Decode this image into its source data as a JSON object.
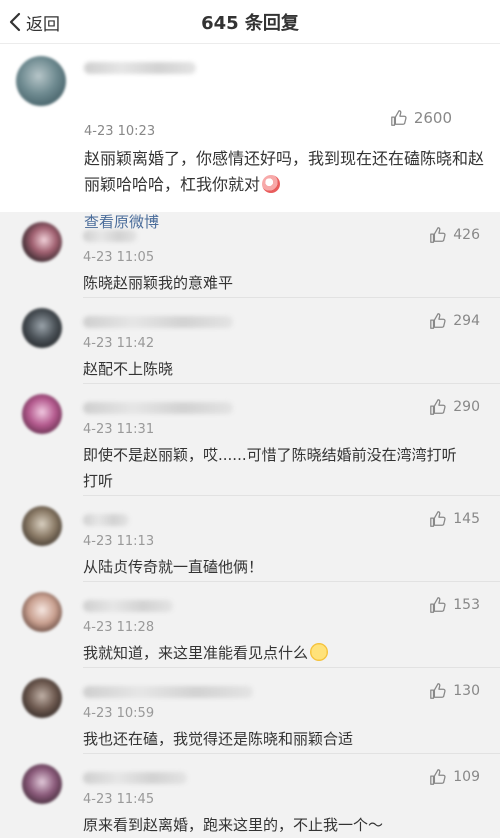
{
  "header": {
    "back_label": "返回",
    "title": "645 条回复"
  },
  "main_comment": {
    "time": "4-23 10:23",
    "likes": "2600",
    "text": "赵丽颖离婚了，你感情还好吗，我到现在还在磕陈晓和赵丽颖哈哈哈，杠我你就对",
    "view_original": "查看原微博"
  },
  "replies": [
    {
      "time": "4-23 11:05",
      "likes": "426",
      "text": "陈晓赵丽颖我的意难平"
    },
    {
      "time": "4-23 11:42",
      "likes": "294",
      "text": "赵配不上陈晓"
    },
    {
      "time": "4-23 11:31",
      "likes": "290",
      "text": "即使不是赵丽颖，哎......可惜了陈晓结婚前没在湾湾打听打听"
    },
    {
      "time": "4-23 11:13",
      "likes": "145",
      "text": "从陆贞传奇就一直磕他俩！"
    },
    {
      "time": "4-23 11:28",
      "likes": "153",
      "text": "我就知道，来这里准能看见点什么"
    },
    {
      "time": "4-23 10:59",
      "likes": "130",
      "text": "我也还在磕，我觉得还是陈晓和丽颖合适"
    },
    {
      "time": "4-23 11:45",
      "likes": "109",
      "text": "原来看到赵离婚，跑来这里的，不止我一个～"
    }
  ]
}
